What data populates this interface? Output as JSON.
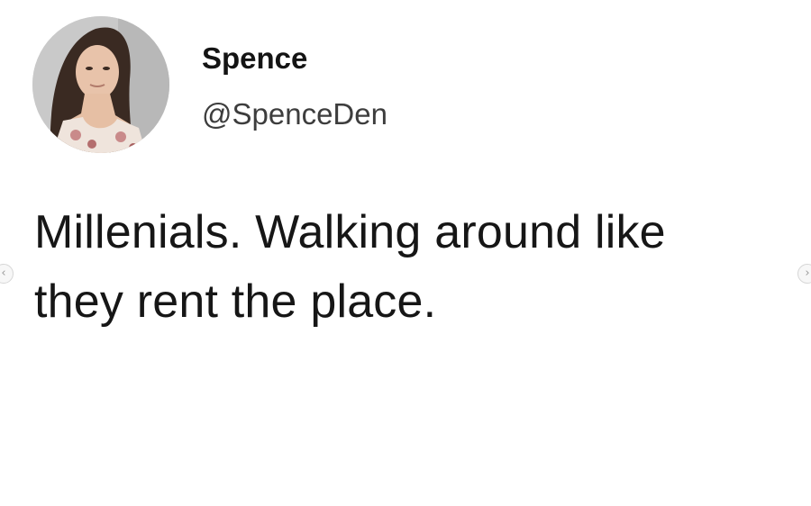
{
  "tweet": {
    "author": {
      "display_name": "Spence",
      "handle": "@SpenceDen",
      "avatar_icon": "profile-photo"
    },
    "text_lines": [
      "Millenials. Walking around like",
      "they rent the place."
    ]
  },
  "carousel": {
    "prev_icon": "chevron-left-icon",
    "next_icon": "chevron-right-icon",
    "prev_glyph": "‹",
    "next_glyph": "›"
  },
  "colors": {
    "background": "#ffffff",
    "text": "#161616",
    "handle": "#3d3d3d"
  }
}
